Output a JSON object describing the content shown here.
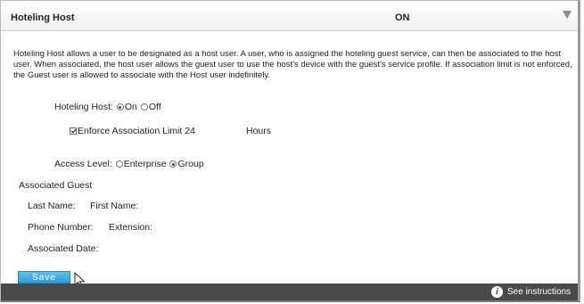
{
  "header": {
    "title": "Hoteling Host",
    "status": "ON"
  },
  "description": "Hoteling Host allows a user to be designated as a host user. A user, who is assigned the hoteling guest service, can then be associated to the host user. When associated, the host user allows the guest user to use the host's device with the guest's service profile. If association limit is not enforced, the Guest user is allowed to associate with the Host user indefinitely.",
  "hoteling_host": {
    "label": "Hoteling Host:",
    "options": [
      {
        "label": "On",
        "selected": true
      },
      {
        "label": "Off",
        "selected": false
      }
    ]
  },
  "enforce_limit": {
    "label": "Enforce Association Limit",
    "checked": true,
    "value": "24",
    "unit": "Hours"
  },
  "access_level": {
    "label": "Access Level:",
    "options": [
      {
        "label": "Enterprise",
        "selected": false
      },
      {
        "label": "Group",
        "selected": true
      }
    ]
  },
  "associated_guest": {
    "heading": "Associated Guest",
    "last_name_label": "Last Name:",
    "first_name_label": "First Name:",
    "phone_label": "Phone Number:",
    "extension_label": "Extension:",
    "date_label": "Associated Date:"
  },
  "buttons": {
    "save": "Save"
  },
  "footer": {
    "link": "See instructions",
    "info_icon": "i"
  }
}
